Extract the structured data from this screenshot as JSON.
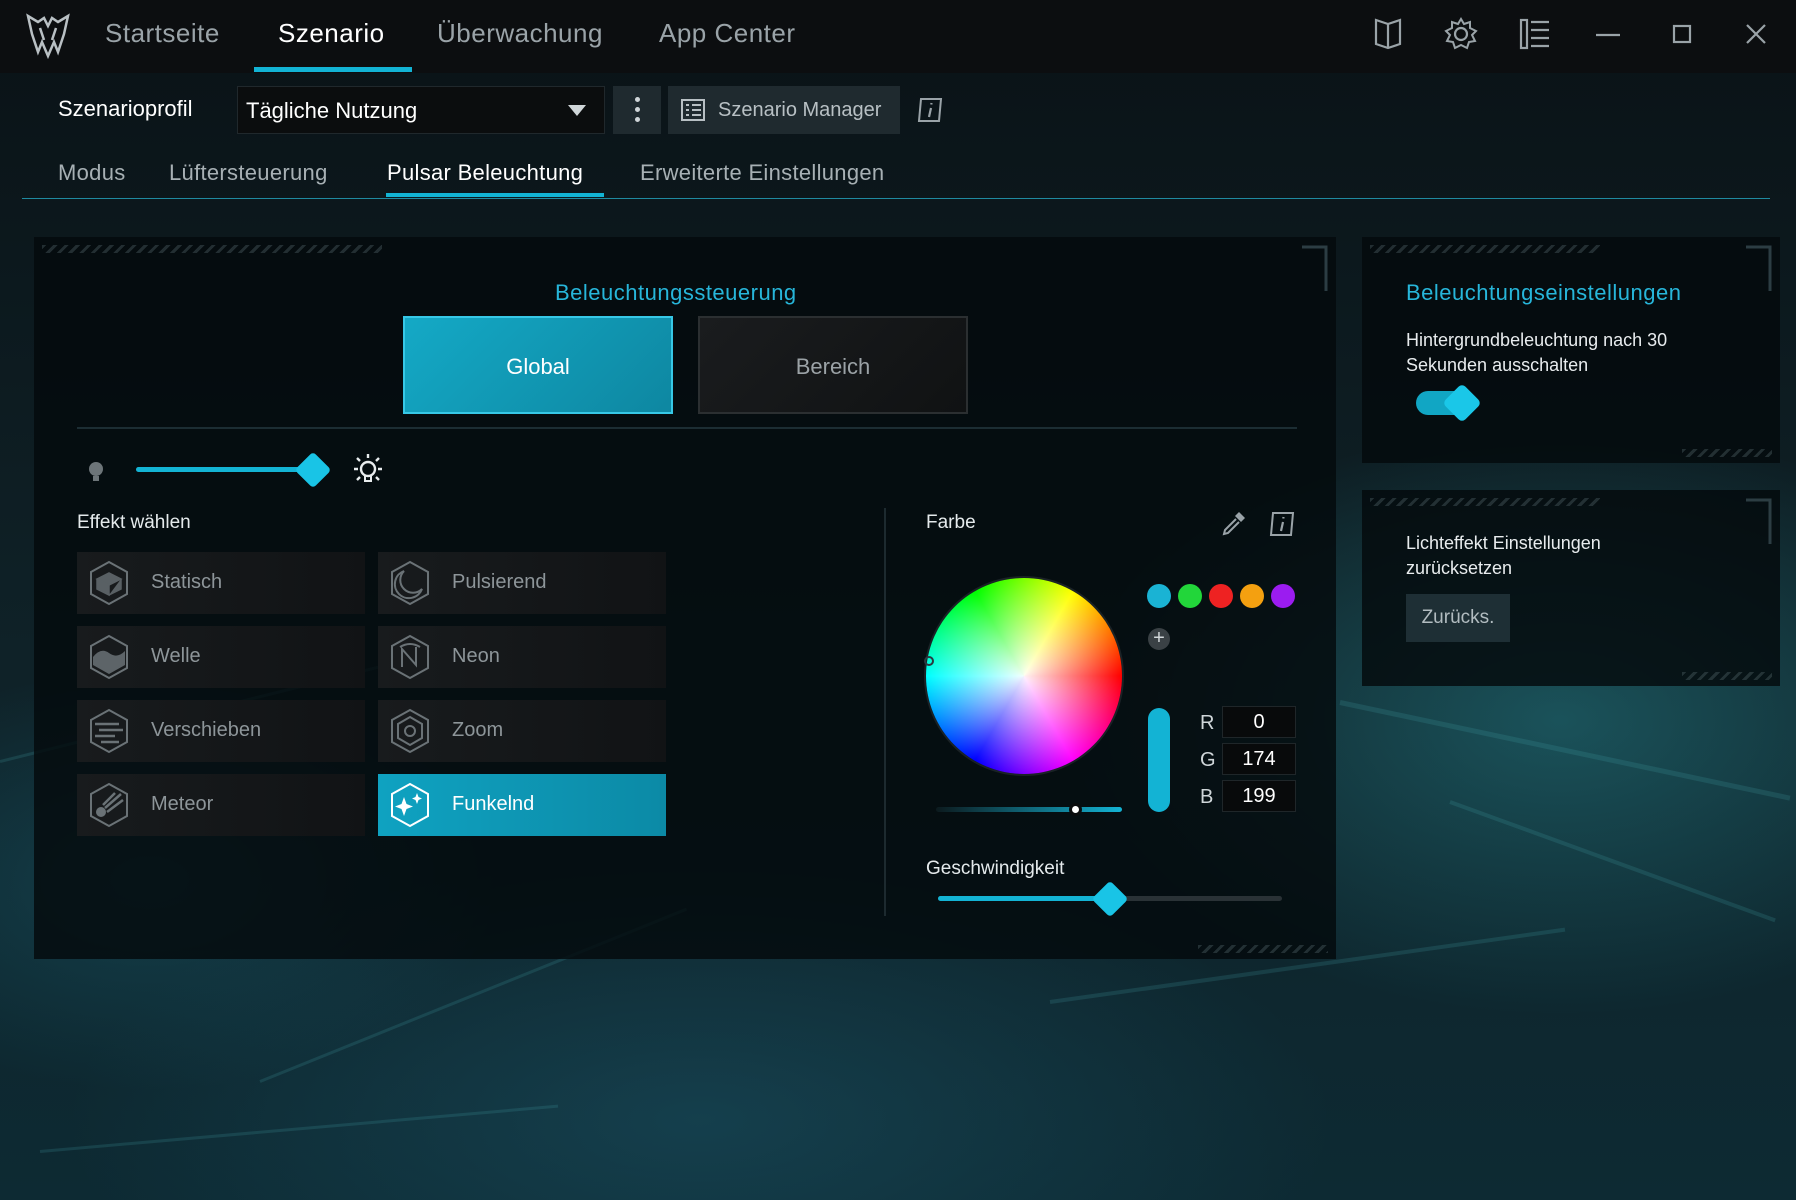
{
  "nav": {
    "tabs": [
      {
        "label": "Startseite"
      },
      {
        "label": "Szenario"
      },
      {
        "label": "Überwachung"
      },
      {
        "label": "App Center"
      }
    ],
    "active_index": 1
  },
  "window_icons": [
    "book-icon",
    "settings-gear-icon",
    "list-icon",
    "minimize-icon",
    "maximize-icon",
    "close-icon"
  ],
  "profile": {
    "label": "Szenarioprofil",
    "selected": "Tägliche Nutzung",
    "manager_label": "Szenario Manager"
  },
  "subtabs": [
    {
      "label": "Modus"
    },
    {
      "label": "Lüftersteuerung"
    },
    {
      "label": "Pulsar Beleuchtung"
    },
    {
      "label": "Erweiterte Einstellungen"
    }
  ],
  "lighting": {
    "title": "Beleuchtungssteuerung",
    "global_label": "Global",
    "bereich_label": "Bereich",
    "brightness_level": 0.93,
    "effect_title": "Effekt wählen",
    "effects": [
      {
        "label": "Statisch",
        "icon": "cube-icon"
      },
      {
        "label": "Pulsierend",
        "icon": "crescent-icon"
      },
      {
        "label": "Welle",
        "icon": "wave-icon"
      },
      {
        "label": "Neon",
        "icon": "neon-icon"
      },
      {
        "label": "Verschieben",
        "icon": "shift-icon"
      },
      {
        "label": "Zoom",
        "icon": "zoom-icon"
      },
      {
        "label": "Meteor",
        "icon": "meteor-icon"
      },
      {
        "label": "Funkelnd",
        "icon": "sparkle-icon"
      }
    ],
    "active_effect": "Funkelnd"
  },
  "color": {
    "title": "Farbe",
    "swatches": [
      "#1ab3d4",
      "#22d63a",
      "#ee2222",
      "#f4a010",
      "#9b1cf0"
    ],
    "r_label": "R",
    "r": "0",
    "g_label": "G",
    "g": "174",
    "b_label": "B",
    "b": "199",
    "saturation_level": 0.75,
    "speed_title": "Geschwindigkeit",
    "speed_level": 0.5
  },
  "settings_panel": {
    "title": "Beleuchtungseinstellungen",
    "backlight_text": "Hintergrundbeleuchtung nach 30 Sekunden ausschalten",
    "backlight_on": true
  },
  "reset_panel": {
    "text": "Lichteffekt Einstellungen zurücksetzen",
    "button_label": "Zurücks."
  },
  "colors": {
    "accent": "#12b3d4",
    "panel_bg": "#04090b",
    "topbar_bg": "#0c0e10"
  }
}
